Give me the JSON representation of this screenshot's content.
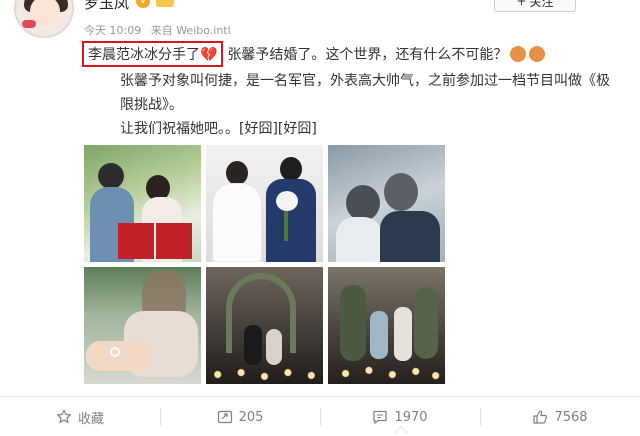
{
  "post": {
    "author": "罗玉凤",
    "verified_icon": "v-badge-icon",
    "member_icon": "crown-icon",
    "follow_label": "关注",
    "follow_icon": "plus-icon",
    "time": "今天 10:09",
    "source": "来自 Weibo.intl",
    "highlight_text": "李晨范冰冰分手了",
    "highlight_emoji": "broken-heart-icon",
    "line1_text": "张馨予结婚了。这个世界，还有什么不可能？",
    "line2_text": "张馨予对象叫何捷，是一名军官，外表高大帅气，之前参加过一档节目叫做《极限挑战》。",
    "line3_text": "让我们祝福她吧。。[好囧][好囧]",
    "photos": [
      {
        "name": "photo-couple-red-booklets"
      },
      {
        "name": "photo-couple-bouquet"
      },
      {
        "name": "photo-couple-forehead"
      },
      {
        "name": "photo-ring-hand"
      },
      {
        "name": "photo-proposal-arch"
      },
      {
        "name": "photo-proposal-lights"
      }
    ]
  },
  "actions": {
    "favorite_label": "收藏",
    "repost_count": "205",
    "comment_count": "1970",
    "like_count": "7568"
  },
  "colors": {
    "highlight_border": "#d8161b",
    "muted_text": "#808080",
    "badge": "#f5a623"
  }
}
